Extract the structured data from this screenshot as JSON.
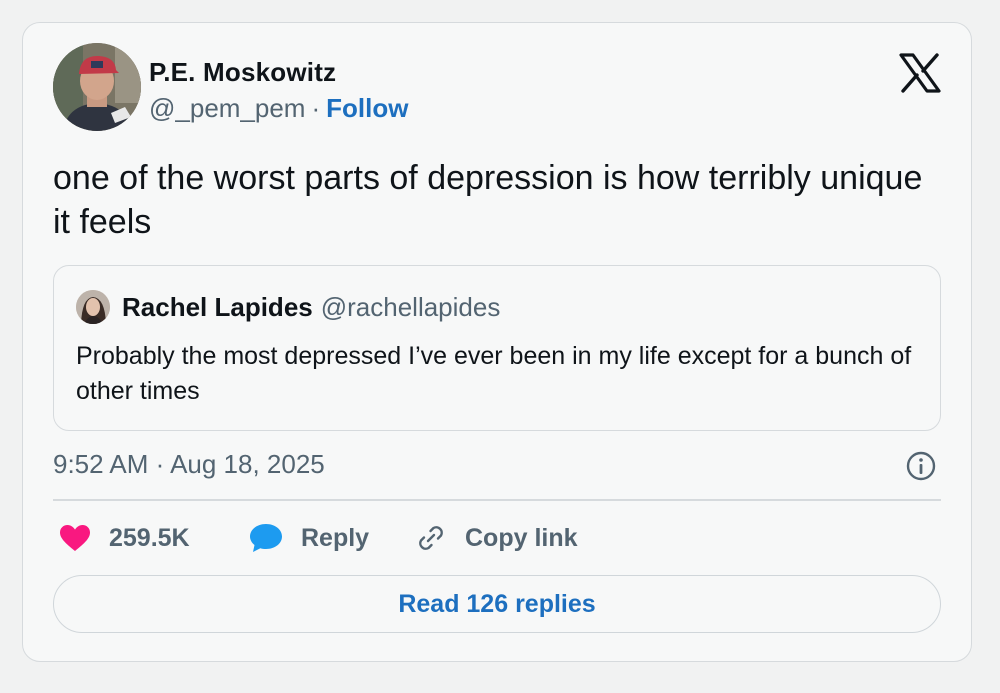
{
  "tweet": {
    "author": {
      "name": "P.E. Moskowitz",
      "handle": "@_pem_pem",
      "separator": "·",
      "follow_label": "Follow"
    },
    "brand_icon": "x-logo-icon",
    "text": "one of the worst parts of depression is how terribly unique it feels",
    "quoted": {
      "name": "Rachel Lapides",
      "handle": "@rachellapides",
      "text": "Probably the most depressed I’ve ever been in my life except for a bunch of other times"
    },
    "timestamp": "9:52 AM · Aug 18, 2025",
    "info_icon": "info-icon",
    "actions": {
      "likes": "259.5K",
      "reply_label": "Reply",
      "copy_link_label": "Copy link"
    },
    "read_replies_label": "Read 126 replies"
  },
  "colors": {
    "like": "#f91880",
    "reply": "#1d9bf0",
    "link": "#1d6fbf",
    "muted": "#536471",
    "border": "#d6dadd"
  }
}
